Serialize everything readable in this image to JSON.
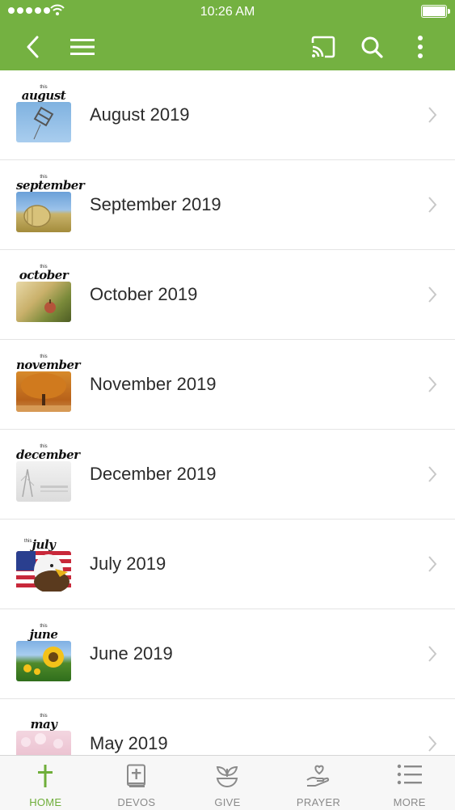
{
  "status_bar": {
    "time": "10:26 AM"
  },
  "colors": {
    "accent": "#74b141",
    "text": "#2b2b2b",
    "tab_inactive": "#8a8a8a"
  },
  "app_bar": {
    "icons": [
      "back-icon",
      "menu-icon",
      "cast-icon",
      "search-icon",
      "more-vertical-icon"
    ]
  },
  "list": {
    "items": [
      {
        "label": "August 2019",
        "thumb_small": "this",
        "thumb_month": "august"
      },
      {
        "label": "September 2019",
        "thumb_small": "this",
        "thumb_month": "september"
      },
      {
        "label": "October 2019",
        "thumb_small": "this",
        "thumb_month": "october"
      },
      {
        "label": "November 2019",
        "thumb_small": "this",
        "thumb_month": "november"
      },
      {
        "label": "December 2019",
        "thumb_small": "this",
        "thumb_month": "december"
      },
      {
        "label": "July 2019",
        "thumb_small": "this",
        "thumb_month": "july"
      },
      {
        "label": "June 2019",
        "thumb_small": "this",
        "thumb_month": "june"
      },
      {
        "label": "May 2019",
        "thumb_small": "this",
        "thumb_month": "may"
      }
    ]
  },
  "tab_bar": {
    "tabs": [
      {
        "label": "HOME",
        "icon": "cross-icon",
        "active": true
      },
      {
        "label": "DEVOS",
        "icon": "bible-icon",
        "active": false
      },
      {
        "label": "GIVE",
        "icon": "plant-icon",
        "active": false
      },
      {
        "label": "PRAYER",
        "icon": "heart-hand-icon",
        "active": false
      },
      {
        "label": "MORE",
        "icon": "list-icon",
        "active": false
      }
    ]
  }
}
